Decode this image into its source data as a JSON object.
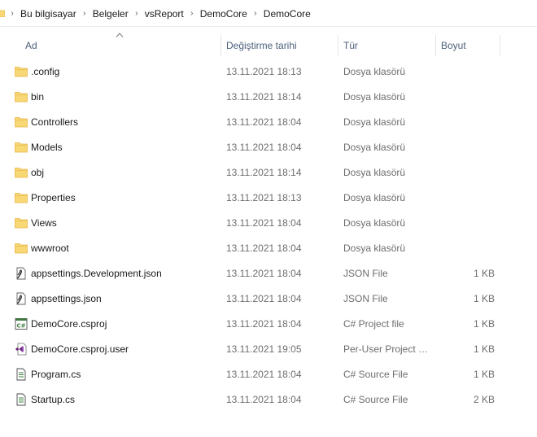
{
  "breadcrumb": [
    "Bu bilgisayar",
    "Belgeler",
    "vsReport",
    "DemoCore",
    "DemoCore"
  ],
  "columns": {
    "name": "Ad",
    "date": "Değiştirme tarihi",
    "type": "Tür",
    "size": "Boyut"
  },
  "files": [
    {
      "icon": "folder-icon",
      "name": ".config",
      "date": "13.11.2021 18:13",
      "type": "Dosya klasörü",
      "size": ""
    },
    {
      "icon": "folder-icon",
      "name": "bin",
      "date": "13.11.2021 18:14",
      "type": "Dosya klasörü",
      "size": ""
    },
    {
      "icon": "folder-icon",
      "name": "Controllers",
      "date": "13.11.2021 18:04",
      "type": "Dosya klasörü",
      "size": ""
    },
    {
      "icon": "folder-icon",
      "name": "Models",
      "date": "13.11.2021 18:04",
      "type": "Dosya klasörü",
      "size": ""
    },
    {
      "icon": "folder-icon",
      "name": "obj",
      "date": "13.11.2021 18:14",
      "type": "Dosya klasörü",
      "size": ""
    },
    {
      "icon": "folder-icon",
      "name": "Properties",
      "date": "13.11.2021 18:13",
      "type": "Dosya klasörü",
      "size": ""
    },
    {
      "icon": "folder-icon",
      "name": "Views",
      "date": "13.11.2021 18:04",
      "type": "Dosya klasörü",
      "size": ""
    },
    {
      "icon": "folder-icon",
      "name": "wwwroot",
      "date": "13.11.2021 18:04",
      "type": "Dosya klasörü",
      "size": ""
    },
    {
      "icon": "json-file-icon",
      "name": "appsettings.Development.json",
      "date": "13.11.2021 18:04",
      "type": "JSON File",
      "size": "1 KB"
    },
    {
      "icon": "json-file-icon",
      "name": "appsettings.json",
      "date": "13.11.2021 18:04",
      "type": "JSON File",
      "size": "1 KB"
    },
    {
      "icon": "csproj-file-icon",
      "name": "DemoCore.csproj",
      "date": "13.11.2021 18:04",
      "type": "C# Project file",
      "size": "1 KB"
    },
    {
      "icon": "visual-studio-file-icon",
      "name": "DemoCore.csproj.user",
      "date": "13.11.2021 19:05",
      "type": "Per-User Project O...",
      "size": "1 KB"
    },
    {
      "icon": "cs-source-file-icon",
      "name": "Program.cs",
      "date": "13.11.2021 18:04",
      "type": "C# Source File",
      "size": "1 KB"
    },
    {
      "icon": "cs-source-file-icon",
      "name": "Startup.cs",
      "date": "13.11.2021 18:04",
      "type": "C# Source File",
      "size": "2 KB"
    }
  ],
  "colors": {
    "folder": "#f8d775",
    "folder_dark": "#e8b74a",
    "header_text": "#4c607a",
    "meta_text": "#6d6d6d",
    "vs_purple": "#68217a"
  }
}
